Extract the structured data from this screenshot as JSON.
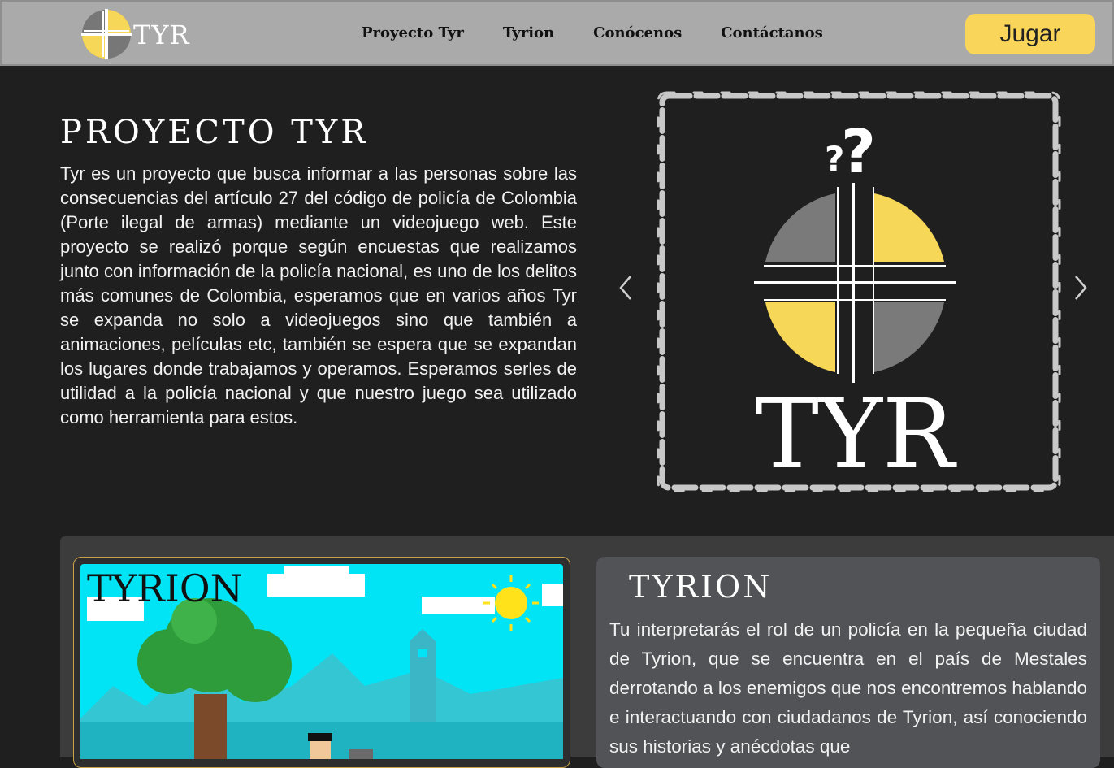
{
  "navbar": {
    "brand_text": "TYR",
    "links": [
      "Proyecto Tyr",
      "Tyrion",
      "Conócenos",
      "Contáctanos"
    ],
    "play_label": "Jugar",
    "colors": {
      "bar": "#aaaaaa",
      "play_button": "#f9d55a"
    }
  },
  "hero": {
    "title": "PROYECTO TYR",
    "text": "Tyr es un proyecto que busca informar a las personas sobre las consecuencias del artículo 27 del código de policía de Colombia (Porte ilegal de armas) mediante un videojuego web. Este proyecto se realizó porque según encuestas que realizamos junto con información de la policía nacional, es uno de los delitos más comunes de Colombia, esperamos que en varios años Tyr se expanda no solo a videojuegos sino que también a animaciones, películas etc, también se espera que se expandan los lugares donde trabajamos y operamos. Esperamos serles de utilidad a la policía nacional y que nuestro juego sea utilizado como herramienta para estos."
  },
  "carousel": {
    "slide_logo_text": "TYR",
    "slide_mark": "??",
    "prev_icon": "chevron-left-icon",
    "next_icon": "chevron-right-icon",
    "colors": {
      "yellow": "#f7d757",
      "gray": "#7a7a7a",
      "chain": "#c8c8c8"
    }
  },
  "game_section": {
    "preview_title": "TYRION",
    "title": "TYRION",
    "text": "Tu interpretarás el rol de un policía en la pequeña ciudad de Tyrion, que se encuentra en el país de Mestales derrotando a los enemigos que nos encontremos hablando e interactuando con ciudadanos de Tyrion, así conociendo sus historias y anécdotas que",
    "colors": {
      "sky": "#00e4f5",
      "tree": "#2e9c3a",
      "sun": "#ffe21a"
    }
  }
}
